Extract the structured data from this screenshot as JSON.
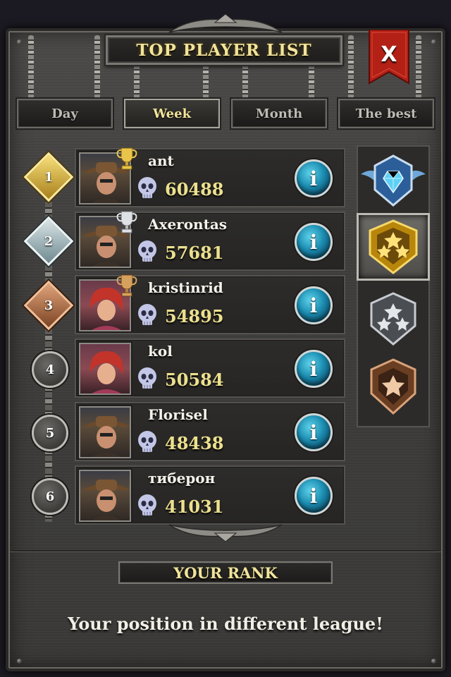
{
  "title": "TOP PLAYER LIST",
  "close_label": "X",
  "tabs": [
    {
      "label": "Day",
      "active": false
    },
    {
      "label": "Week",
      "active": true
    },
    {
      "label": "Month",
      "active": false
    },
    {
      "label": "The best",
      "active": false
    }
  ],
  "players": [
    {
      "rank": "1",
      "name": "ant",
      "score": "60488",
      "trophy": "gold-trophy-icon",
      "avatar": "cowboy-hat-character"
    },
    {
      "rank": "2",
      "name": "Axerontas",
      "score": "57681",
      "trophy": "silver-trophy-icon",
      "avatar": "cowboy-hat-character"
    },
    {
      "rank": "3",
      "name": "kristinrid",
      "score": "54895",
      "trophy": "bronze-trophy-icon",
      "avatar": "red-haired-character"
    },
    {
      "rank": "4",
      "name": "kol",
      "score": "50584",
      "trophy": "",
      "avatar": "red-haired-character"
    },
    {
      "rank": "5",
      "name": "Florisel",
      "score": "48438",
      "trophy": "",
      "avatar": "cowboy-hat-character"
    },
    {
      "rank": "6",
      "name": "тиберон",
      "score": "41031",
      "trophy": "",
      "avatar": "cowboy-hat-character"
    }
  ],
  "info_label": "i",
  "leagues": [
    {
      "icon": "diamond-league-emblem-icon",
      "selected": false
    },
    {
      "icon": "gold-league-emblem-icon",
      "selected": true
    },
    {
      "icon": "silver-league-emblem-icon",
      "selected": false
    },
    {
      "icon": "bronze-league-emblem-icon",
      "selected": false
    }
  ],
  "your_rank_label": "YOUR RANK",
  "league_message": "Your position in different league!",
  "colors": {
    "gold_text": "#f1e49a",
    "score_text": "#ece08e",
    "info_blue": "#1b8cb0",
    "close_red": "#b32016"
  }
}
